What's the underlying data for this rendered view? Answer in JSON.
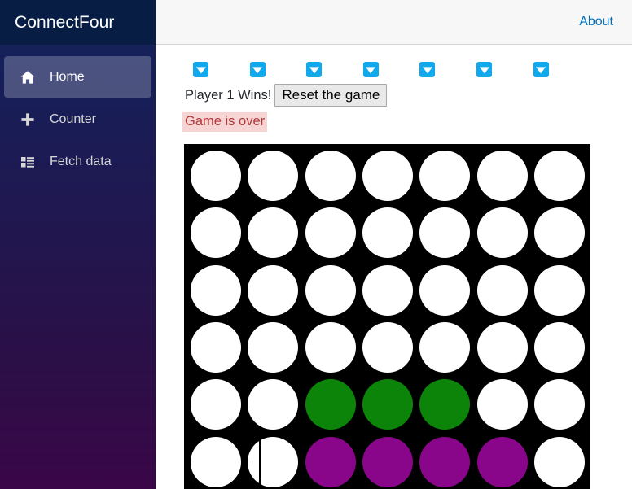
{
  "app": {
    "brand": "ConnectFour"
  },
  "topbar": {
    "about_label": "About"
  },
  "sidebar": {
    "items": [
      {
        "label": "Home",
        "icon": "home-icon",
        "active": true
      },
      {
        "label": "Counter",
        "icon": "plus-icon",
        "active": false
      },
      {
        "label": "Fetch data",
        "icon": "list-icon",
        "active": false
      }
    ]
  },
  "game": {
    "winner_text": "Player 1 Wins!",
    "reset_label": "Reset the game",
    "game_over_text": "Game is over",
    "drop_buttons": [
      {
        "column": 1,
        "icon": "drop-arrow-down-icon"
      },
      {
        "column": 2,
        "icon": "drop-arrow-down-icon"
      },
      {
        "column": 3,
        "icon": "drop-arrow-down-icon"
      },
      {
        "column": 4,
        "icon": "drop-arrow-down-icon"
      },
      {
        "column": 5,
        "icon": "drop-arrow-down-icon"
      },
      {
        "column": 6,
        "icon": "drop-arrow-down-icon"
      },
      {
        "column": 7,
        "icon": "drop-arrow-down-icon"
      }
    ],
    "colors": {
      "board": "#000000",
      "empty": "#ffffff",
      "player1": "#890589",
      "player2": "#0c8409",
      "drop_button": "#11a9eb",
      "accent_link": "#0071c1",
      "alert_bg": "#f7d4d4",
      "alert_text": "#b13838"
    },
    "rows": 6,
    "columns": 7,
    "board": [
      [
        "empty",
        "empty",
        "empty",
        "empty",
        "empty",
        "empty",
        "empty"
      ],
      [
        "empty",
        "empty",
        "empty",
        "empty",
        "empty",
        "empty",
        "empty"
      ],
      [
        "empty",
        "empty",
        "empty",
        "empty",
        "empty",
        "empty",
        "empty"
      ],
      [
        "empty",
        "empty",
        "empty",
        "empty",
        "empty",
        "empty",
        "empty"
      ],
      [
        "empty",
        "empty",
        "green",
        "green",
        "green",
        "empty",
        "empty"
      ],
      [
        "empty",
        "empty-caret",
        "purple",
        "purple",
        "purple",
        "purple",
        "empty"
      ]
    ]
  }
}
